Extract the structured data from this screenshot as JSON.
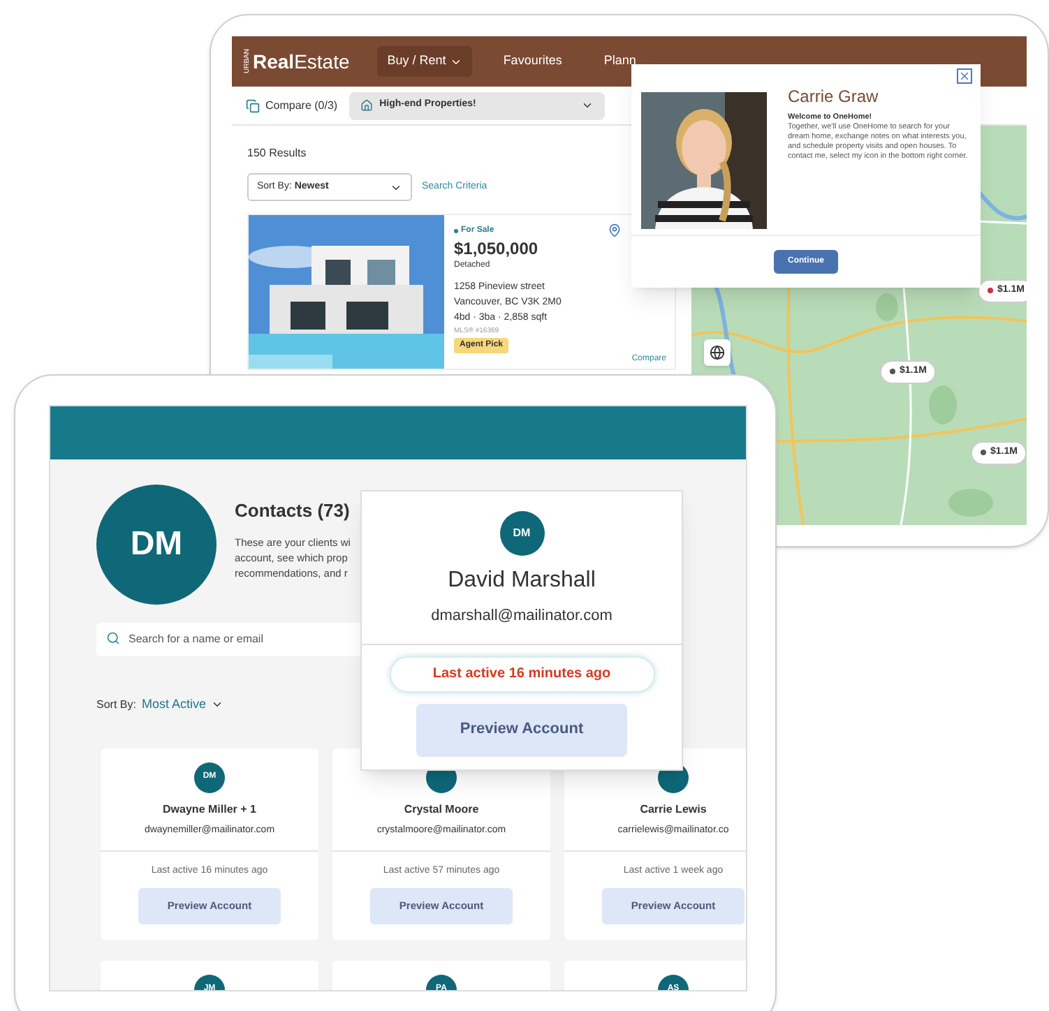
{
  "listing_app": {
    "logo": {
      "tag": "URBAN",
      "bold": "Real",
      "rest": "Estate"
    },
    "nav": [
      {
        "label": "Buy / Rent",
        "kind": "dropdown"
      },
      {
        "label": "Favourites",
        "kind": "link"
      },
      {
        "label": "Plann",
        "kind": "link"
      }
    ],
    "compare": "Compare (0/3)",
    "saved_search": "High-end Properties!",
    "results_count": "150 Results",
    "sort": {
      "label": "Sort By:",
      "value": "Newest"
    },
    "search_criteria": "Search Criteria",
    "listing": {
      "status": "For Sale",
      "price": "$1,050,000",
      "type": "Detached",
      "address_1": "1258 Pineview street",
      "address_2": "Vancouver, BC V3K 2M0",
      "specs": "4bd · 3ba · 2,858 sqft",
      "mls": "MLS® #16369",
      "badge": "Agent Pick",
      "compare_link": "Compare"
    },
    "map_markers": [
      {
        "price": "$1.1M",
        "color": "#d0304a"
      },
      {
        "price": "$1.1M",
        "color": "#555555"
      },
      {
        "price": "$1.1M",
        "color": "#555555"
      }
    ]
  },
  "agent_dialog": {
    "name": "Carrie Graw",
    "greeting": "Welcome to OneHome!",
    "message": "Together, we'll use OneHome to search for your dream home, exchange notes on what interests you, and schedule property visits and open houses. To contact me, select my icon in the bottom right corner.",
    "button": "Continue"
  },
  "contacts_app": {
    "avatar": "DM",
    "title": "Contacts (73)",
    "description": [
      "These are your clients wi",
      "account, see which prop",
      "recommendations, and r"
    ],
    "search": {
      "placeholder": "Search for a name or email"
    },
    "sort": {
      "label": "Sort By:",
      "value": "Most Active"
    },
    "cards": [
      {
        "initials": "DM",
        "name": "Dwayne Miller + 1",
        "email": "dwaynemiller@mailinator.com",
        "last_active": "Last active 16 minutes ago",
        "button": "Preview Account"
      },
      {
        "name": "Crystal Moore",
        "email": "crystalmoore@mailinator.com",
        "last_active": "Last active 57 minutes ago",
        "button": "Preview Account"
      },
      {
        "name": "Carrie Lewis",
        "email": "carrielewis@mailinator.co",
        "last_active": "Last active 1 week ago",
        "button": "Preview Account"
      },
      {
        "initials": "JM"
      },
      {
        "initials": "PA"
      },
      {
        "initials": "AS"
      }
    ]
  },
  "contact_popup": {
    "initials": "DM",
    "name": "David Marshall",
    "email": "dmarshall@mailinator.com",
    "last_active": "Last active 16 minutes ago",
    "button": "Preview Account"
  }
}
